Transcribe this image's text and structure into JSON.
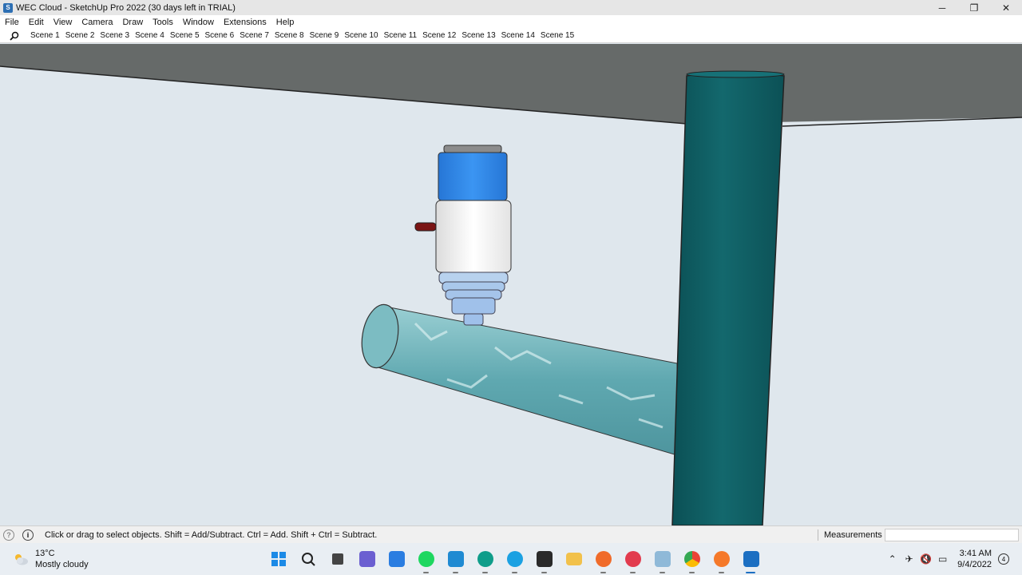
{
  "window": {
    "title": "WEC Cloud - SketchUp Pro 2022 (30 days left in TRIAL)",
    "minimize_glyph": "─",
    "restore_glyph": "❐",
    "close_glyph": "✕"
  },
  "menu": [
    "File",
    "Edit",
    "View",
    "Camera",
    "Draw",
    "Tools",
    "Window",
    "Extensions",
    "Help"
  ],
  "scenes": [
    "Scene 1",
    "Scene 2",
    "Scene 3",
    "Scene 4",
    "Scene 5",
    "Scene 6",
    "Scene 7",
    "Scene 8",
    "Scene 9",
    "Scene 10",
    "Scene 11",
    "Scene 12",
    "Scene 13",
    "Scene 14",
    "Scene 15"
  ],
  "colors": {
    "sky": "#dfe7ed",
    "ceiling": "#666a69",
    "column": "#0f5e63",
    "pipe": "#6fb5bd",
    "cap_blue": "#2f86e8",
    "cap_white": "#f4f4f4",
    "nozzle": "#b7d3ef"
  },
  "status": {
    "hint": "Click or drag to select objects. Shift = Add/Subtract. Ctrl = Add. Shift + Ctrl = Subtract.",
    "measurements_label": "Measurements",
    "measurements_value": ""
  },
  "taskbar": {
    "temperature": "13°C",
    "weather": "Mostly cloudy",
    "time": "3:41 AM",
    "date": "9/4/2022",
    "notification_count": "4",
    "apps": [
      "start-icon",
      "search-icon",
      "file-explorer-icon",
      "teams-icon",
      "store-icon",
      "spotify-icon",
      "vscode-icon",
      "edge-icon",
      "skype-icon",
      "game-icon",
      "folder-icon",
      "firefox-icon",
      "recorder-icon",
      "photos-icon",
      "chrome-icon",
      "blender-icon",
      "sketchup-icon"
    ]
  }
}
